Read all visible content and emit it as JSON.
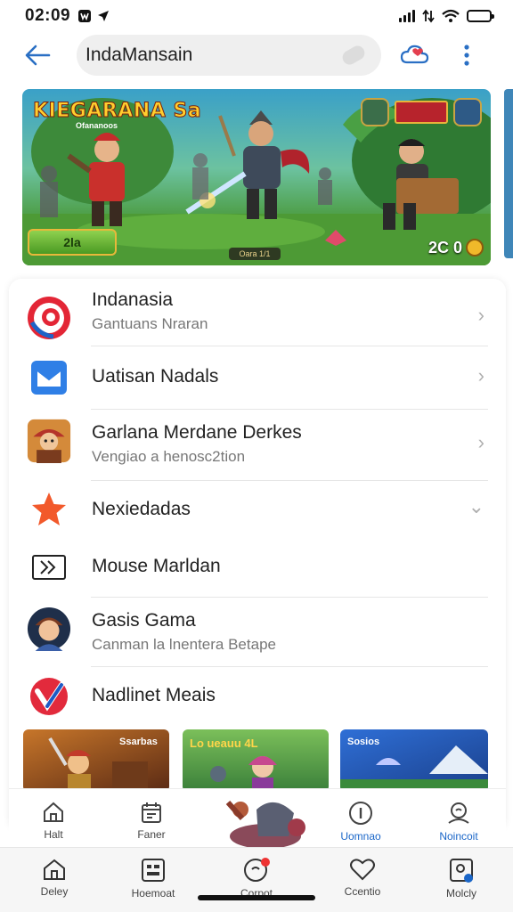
{
  "status_bar": {
    "time": "02:09"
  },
  "header": {
    "search_text": "IndaMansain"
  },
  "banner": {
    "title": "KIEGARANA",
    "title_suffix": "Sa",
    "subtitle": "Ofananoos",
    "play_label": "2la",
    "bottom_label": "Oara 1/1",
    "score": "2C 0",
    "colors": {
      "sky": "#3aa0c8",
      "grass": "#4a9a3c"
    }
  },
  "list": {
    "items": [
      {
        "title": "Indanasia",
        "subtitle": "Gantuans Nraran",
        "icon": "red-radar-icon",
        "chevron": "›"
      },
      {
        "title": "Uatisan Nadals",
        "subtitle": "",
        "icon": "blue-mail-icon",
        "chevron": "›"
      },
      {
        "title": "Garlana Merdane Derkes",
        "subtitle": "Vengiao a henosc2tion",
        "icon": "game-character-icon",
        "chevron": "›"
      },
      {
        "title": "Nexiedadas",
        "subtitle": "",
        "icon": "orange-star-icon",
        "chevron": "⌄"
      },
      {
        "title": "Mouse Marldan",
        "subtitle": "",
        "icon": "forward-box-icon",
        "chevron": ""
      },
      {
        "title": "Gasis Gama",
        "subtitle": "Canman la lnentera Betape",
        "icon": "avatar-icon",
        "chevron": ""
      },
      {
        "title": "Nadlinet Meais",
        "subtitle": "",
        "icon": "red-blue-v-icon",
        "chevron": ""
      }
    ],
    "thumbnails": [
      {
        "label": "Ssarbas"
      },
      {
        "label": "Lo ueauu 4L"
      },
      {
        "label": "Sosios"
      }
    ]
  },
  "nav_upper": {
    "items": [
      {
        "label": "Halt",
        "icon": "home-icon",
        "active": false
      },
      {
        "label": "Faner",
        "icon": "calendar-icon",
        "active": false
      },
      {
        "label": "Uomnao",
        "icon": "info-icon",
        "active": true
      },
      {
        "label": "Noincoit",
        "icon": "person-search-icon",
        "active": true
      }
    ]
  },
  "nav_lower": {
    "items": [
      {
        "label": "Deley",
        "icon": "home-icon"
      },
      {
        "label": "Hoemoat",
        "icon": "grid-card-icon"
      },
      {
        "label": "Corpot",
        "icon": "chat-bubble-icon",
        "badge": true
      },
      {
        "label": "Ccentio",
        "icon": "heart-icon"
      },
      {
        "label": "Molcly",
        "icon": "profile-badge-icon"
      }
    ]
  },
  "colors": {
    "accent": "#1a66c8",
    "divider": "#e6e6e6"
  }
}
